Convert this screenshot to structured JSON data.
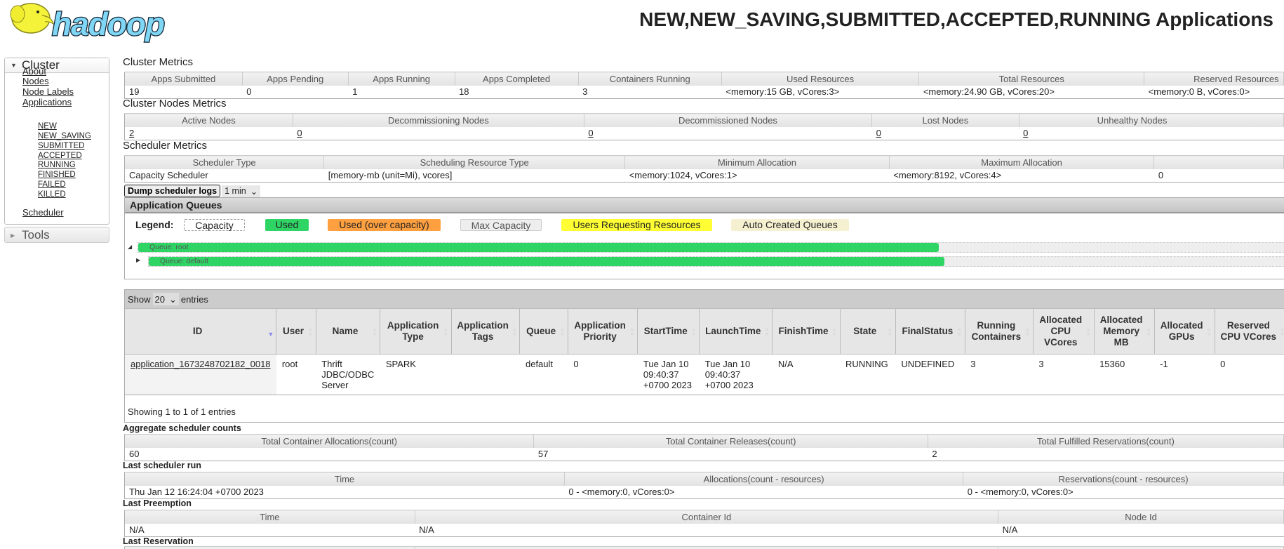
{
  "header": {
    "logo_text": "hadoop",
    "title": "NEW,NEW_SAVING,SUBMITTED,ACCEPTED,RUNNING Applications"
  },
  "sidebar": {
    "cluster_label": "Cluster",
    "links": [
      {
        "label": "About"
      },
      {
        "label": "Nodes"
      },
      {
        "label": "Node Labels"
      },
      {
        "label": "Applications"
      }
    ],
    "app_states": [
      {
        "label": "NEW"
      },
      {
        "label": "NEW_SAVING"
      },
      {
        "label": "SUBMITTED"
      },
      {
        "label": "ACCEPTED"
      },
      {
        "label": "RUNNING"
      },
      {
        "label": "FINISHED"
      },
      {
        "label": "FAILED"
      },
      {
        "label": "KILLED"
      }
    ],
    "scheduler_label": "Scheduler",
    "tools_label": "Tools"
  },
  "cluster_metrics": {
    "title": "Cluster Metrics",
    "headers": [
      "Apps Submitted",
      "Apps Pending",
      "Apps Running",
      "Apps Completed",
      "Containers Running",
      "Used Resources",
      "Total Resources",
      "Reserved Resources"
    ],
    "values": [
      "19",
      "0",
      "1",
      "18",
      "3",
      "<memory:15 GB, vCores:3>",
      "<memory:24.90 GB, vCores:20>",
      "<memory:0 B, vCores:0>"
    ]
  },
  "node_metrics": {
    "title": "Cluster Nodes Metrics",
    "headers": [
      "Active Nodes",
      "Decommissioning Nodes",
      "Decommissioned Nodes",
      "Lost Nodes",
      "Unhealthy Nodes"
    ],
    "values": [
      "2",
      "0",
      "0",
      "0",
      "0"
    ]
  },
  "scheduler_metrics": {
    "title": "Scheduler Metrics",
    "headers": [
      "Scheduler Type",
      "Scheduling Resource Type",
      "Minimum Allocation",
      "Maximum Allocation",
      ""
    ],
    "values": [
      "Capacity Scheduler",
      "[memory-mb (unit=Mi), vcores]",
      "<memory:1024, vCores:1>",
      "<memory:8192, vCores:4>",
      "0"
    ]
  },
  "dump": {
    "button": "Dump scheduler logs",
    "interval": "1 min"
  },
  "queues": {
    "title": "Application Queues",
    "legend_label": "Legend:",
    "legend": [
      {
        "label": "Capacity",
        "color": "#ffffff"
      },
      {
        "label": "Used",
        "color": "#2ed565"
      },
      {
        "label": "Used (over capacity)",
        "color": "#ffa040"
      },
      {
        "label": "Max Capacity",
        "color": "#eeeeee"
      },
      {
        "label": "Users Requesting Resources",
        "color": "#ffff33"
      },
      {
        "label": "Auto Created Queues",
        "color": "#f5f0d0"
      }
    ],
    "items": [
      {
        "label": "Queue: root"
      },
      {
        "label": "Queue: default"
      }
    ]
  },
  "apps": {
    "show_label": "Show",
    "page_size": "20",
    "entries_label": "entries",
    "columns": [
      "ID",
      "User",
      "Name",
      "Application Type",
      "Application Tags",
      "Queue",
      "Application Priority",
      "StartTime",
      "LaunchTime",
      "FinishTime",
      "State",
      "FinalStatus",
      "Running Containers",
      "Allocated CPU VCores",
      "Allocated Memory MB",
      "Allocated GPUs",
      "Reserved CPU VCores"
    ],
    "rows": [
      [
        "application_1673248702182_0018",
        "root",
        "Thrift JDBC/ODBC Server",
        "SPARK",
        "",
        "default",
        "0",
        "Tue Jan 10 09:40:37 +0700 2023",
        "Tue Jan 10 09:40:37 +0700 2023",
        "N/A",
        "RUNNING",
        "UNDEFINED",
        "3",
        "3",
        "15360",
        "-1",
        "0"
      ]
    ],
    "footer": "Showing 1 to 1 of 1 entries"
  },
  "aggregate": {
    "title": "Aggregate scheduler counts",
    "headers": [
      "Total Container Allocations(count)",
      "Total Container Releases(count)",
      "Total Fulfilled Reservations(count)"
    ],
    "values": [
      "60",
      "57",
      "2"
    ]
  },
  "last_run": {
    "title": "Last scheduler run",
    "headers": [
      "Time",
      "Allocations(count - resources)",
      "Reservations(count - resources)"
    ],
    "values": [
      "Thu Jan 12 16:24:04 +0700 2023",
      "0 - <memory:0, vCores:0>",
      "0 - <memory:0, vCores:0>"
    ]
  },
  "last_preemption": {
    "title": "Last Preemption",
    "headers": [
      "Time",
      "Container Id",
      "Node Id"
    ],
    "values": [
      "N/A",
      "N/A",
      "N/A"
    ]
  },
  "last_reservation": {
    "title": "Last Reservation"
  }
}
